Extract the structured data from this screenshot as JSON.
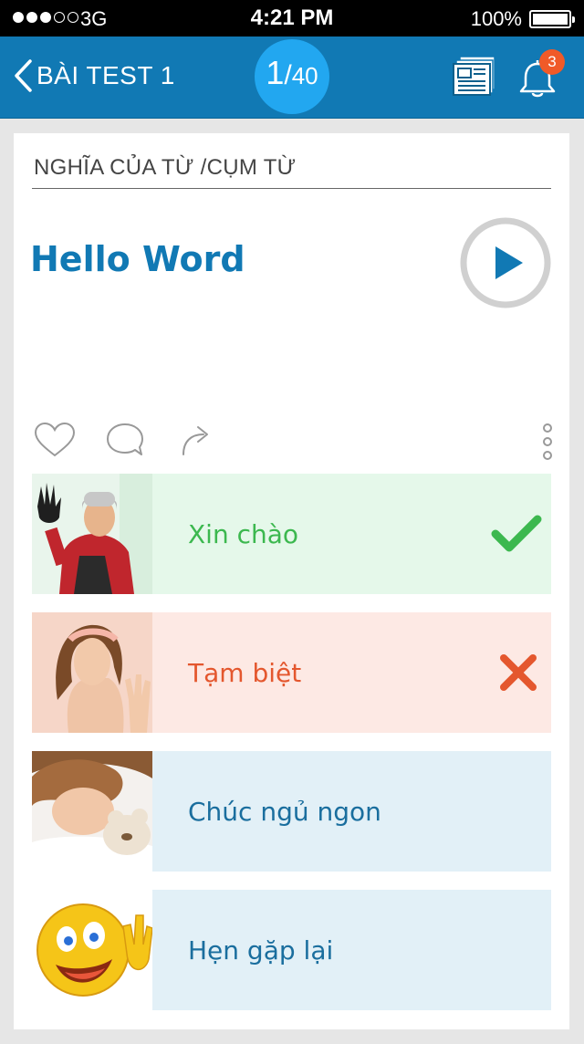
{
  "status_bar": {
    "carrier": "3G",
    "time": "4:21 PM",
    "battery": "100%"
  },
  "header": {
    "title": "BÀI TEST 1",
    "progress_current": "1",
    "progress_separator": "/",
    "progress_total": "40",
    "notification_count": "3"
  },
  "card": {
    "section_title": "NGHĨA CỦA TỪ /CỤM TỪ",
    "word": "Hello Word"
  },
  "options": [
    {
      "label": "Xin chào",
      "state": "correct",
      "image": "man-waving"
    },
    {
      "label": "Tạm biệt",
      "state": "wrong",
      "image": "woman-waving"
    },
    {
      "label": "Chúc ngủ ngon",
      "state": "neutral",
      "image": "child-sleeping"
    },
    {
      "label": "Hẹn gặp lại",
      "state": "neutral",
      "image": "smiley-waving"
    }
  ],
  "colors": {
    "header_bg": "#1179b4",
    "accent": "#22a7f0",
    "correct": "#3cb84f",
    "wrong": "#e4572e",
    "badge": "#f05a28"
  }
}
